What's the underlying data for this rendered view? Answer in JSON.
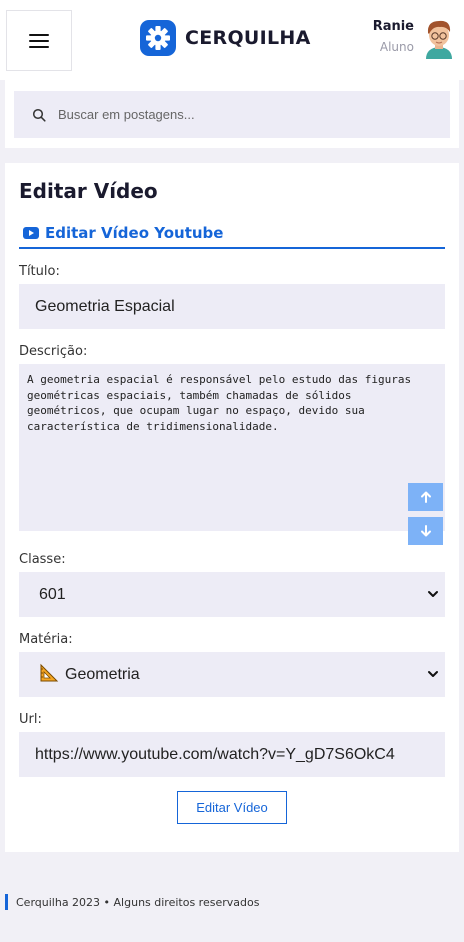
{
  "header": {
    "brand": "CERQUILHA",
    "user_name": "Ranie",
    "user_role": "Aluno",
    "accent_color": "#1565d8"
  },
  "search": {
    "placeholder": "Buscar em postagens..."
  },
  "form": {
    "title": "Editar Vídeo",
    "tab_label": "Editar Vídeo Youtube",
    "title_label": "Título:",
    "title_value": "Geometria Espacial",
    "description_label": "Descrição:",
    "description_value": "A geometria espacial é responsável pelo estudo das figuras geométricas espaciais, também chamadas de sólidos geométricos, que ocupam lugar no espaço, devido sua característica de tridimensionalidade.",
    "class_label": "Classe:",
    "class_value": "601",
    "subject_label": "Matéria:",
    "subject_icon": "triangular-ruler-icon",
    "subject_value": "Geometria",
    "url_label": "Url:",
    "url_value": "https://www.youtube.com/watch?v=Y_gD7S6OkC4",
    "submit_label": "Editar Vídeo"
  },
  "footer": {
    "text": "Cerquilha 2023 • Alguns direitos reservados"
  }
}
